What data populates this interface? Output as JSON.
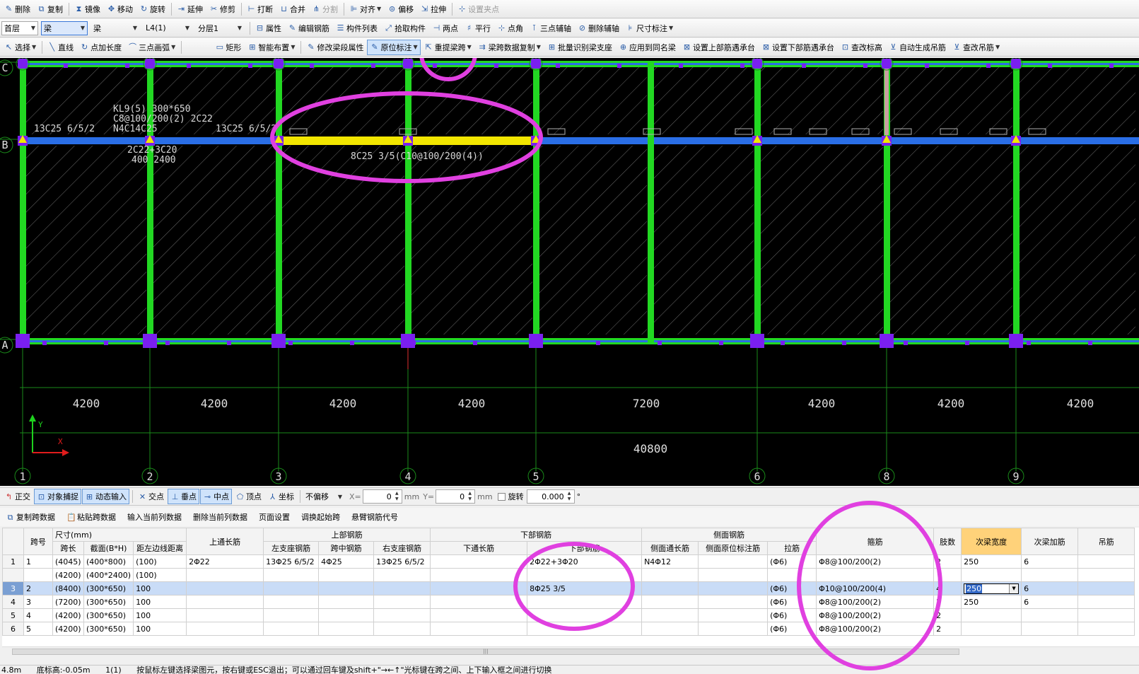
{
  "colors": {
    "accent_green": "#22d822",
    "beam_blue": "#2a6ee6",
    "selected_beam": "#f2e600",
    "column": "#7a1ff0",
    "highlight_circle": "#e040e0",
    "axis": "#a8a8a8",
    "grid_line": "#1a8a1a",
    "header_highlight": "#ffd27a"
  },
  "toolbar1": {
    "items": [
      {
        "label": "删除",
        "icon": "eraser-icon"
      },
      {
        "label": "复制",
        "icon": "copy-icon"
      },
      {
        "label": "镜像",
        "icon": "mirror-icon"
      },
      {
        "label": "移动",
        "icon": "move-icon"
      },
      {
        "label": "旋转",
        "icon": "rotate-icon"
      },
      {
        "label": "延伸",
        "icon": "extend-icon"
      },
      {
        "label": "修剪",
        "icon": "trim-icon"
      },
      {
        "label": "打断",
        "icon": "break-icon"
      },
      {
        "label": "合并",
        "icon": "merge-icon"
      },
      {
        "label": "分割",
        "icon": "split-icon"
      },
      {
        "label": "对齐",
        "icon": "align-icon"
      },
      {
        "label": "偏移",
        "icon": "offset-icon"
      },
      {
        "label": "拉伸",
        "icon": "stretch-icon"
      },
      {
        "label": "设置夹点",
        "icon": "grip-icon"
      }
    ]
  },
  "toolbar2": {
    "floor": "首层",
    "category": "梁",
    "type": "梁",
    "component": "L4(1)",
    "layer": "分层1",
    "items": [
      {
        "label": "属性"
      },
      {
        "label": "编辑钢筋"
      },
      {
        "label": "构件列表"
      },
      {
        "label": "拾取构件"
      },
      {
        "label": "两点"
      },
      {
        "label": "平行"
      },
      {
        "label": "点角"
      },
      {
        "label": "三点辅轴"
      },
      {
        "label": "删除辅轴"
      },
      {
        "label": "尺寸标注"
      }
    ]
  },
  "toolbar3": {
    "items": [
      {
        "label": "选择"
      },
      {
        "label": "直线"
      },
      {
        "label": "点加长度"
      },
      {
        "label": "三点画弧"
      },
      {
        "label": "矩形"
      },
      {
        "label": "智能布置"
      },
      {
        "label": "修改梁段属性"
      },
      {
        "label": "原位标注"
      },
      {
        "label": "重提梁跨"
      },
      {
        "label": "梁跨数据复制"
      },
      {
        "label": "批量识别梁支座"
      },
      {
        "label": "应用到同名梁"
      },
      {
        "label": "设置上部筋遇承台"
      },
      {
        "label": "设置下部筋遇承台"
      },
      {
        "label": "查改标高"
      },
      {
        "label": "自动生成吊筋"
      },
      {
        "label": "查改吊筋"
      }
    ]
  },
  "canvas": {
    "row_axes": [
      "C",
      "B",
      "A"
    ],
    "column_axes": [
      "1",
      "2",
      "3",
      "4",
      "5",
      "6",
      "8",
      "9"
    ],
    "span_dims": [
      "4200",
      "4200",
      "4200",
      "4200",
      "7200",
      "4200",
      "4200",
      "4200"
    ],
    "total_dim": "40800",
    "labels": {
      "beam_name": "KL9(5) 300*650",
      "stirrup": "C8@100/200(2) 2C22",
      "side": "N4C14C25",
      "left_support": "13C25 6/5/2",
      "right_support": "13C25 6/5/2",
      "bottom1": "2C22+3C20",
      "bottom1b": "400 2400",
      "selected_bottom": "8C25 3/5(C10@100/200(4))"
    },
    "ucs": {
      "x": "X",
      "y": "Y"
    }
  },
  "statusbar": {
    "ortho": "正交",
    "snap": "对象捕捉",
    "dyn": "动态输入",
    "intersect": "交点",
    "perp": "垂点",
    "mid": "中点",
    "vertex": "顶点",
    "coord": "坐标",
    "offset": "不偏移",
    "x_label": "X=",
    "x_val": "0",
    "y_label": "Y=",
    "y_val": "0",
    "unit": "mm",
    "rotate": "旋转",
    "rotate_val": "0.000",
    "degree": "°"
  },
  "grid_toolbar": {
    "items": [
      "复制跨数据",
      "粘贴跨数据",
      "输入当前列数据",
      "删除当前列数据",
      "页面设置",
      "调换起始跨",
      "悬臂钢筋代号"
    ]
  },
  "table": {
    "group_headers": {
      "span_no": "跨号",
      "size": "尺寸(mm)",
      "top_long": "上通长筋",
      "top_bars": "上部钢筋",
      "bottom_bars": "下部钢筋",
      "side_bars": "侧面钢筋",
      "stirrup": "箍筋",
      "legs": "肢数",
      "sec_width": "次梁宽度",
      "sec_add": "次梁加筋",
      "hanger": "吊筋"
    },
    "sub_headers": {
      "len": "跨长",
      "section": "截面(B*H)",
      "dist": "距左边线距离",
      "left_sup": "左支座钢筋",
      "mid": "跨中钢筋",
      "right_sup": "右支座钢筋",
      "bot_long": "下通长筋",
      "bot": "下部钢筋",
      "side_long": "侧面通长筋",
      "side_orig": "侧面原位标注筋",
      "tie": "拉筋"
    },
    "rows": [
      {
        "rn": "1",
        "span": "1",
        "len": "(4045)",
        "sec": "(400*800)",
        "dist": "(100)",
        "top_long": "2Φ22",
        "left": "13Φ25 6/5/2",
        "mid": "4Φ25",
        "right": "13Φ25 6/5/2",
        "bot_long": "",
        "bot": "2Φ22+3Φ20",
        "side_long": "N4Φ12",
        "side_orig": "",
        "tie": "(Φ6)",
        "stir": "Φ8@100/200(2)",
        "legs": "2",
        "sw": "250",
        "sa": "6",
        "hang": ""
      },
      {
        "rn": "",
        "span": "",
        "len": "(4200)",
        "sec": "(400*2400)",
        "dist": "(100)",
        "top_long": "",
        "left": "",
        "mid": "",
        "right": "",
        "bot_long": "",
        "bot": "",
        "side_long": "",
        "side_orig": "",
        "tie": "",
        "stir": "",
        "legs": "",
        "sw": "",
        "sa": "",
        "hang": ""
      },
      {
        "rn": "3",
        "span": "2",
        "len": "(8400)",
        "sec": "(300*650)",
        "dist": "100",
        "top_long": "",
        "left": "",
        "mid": "",
        "right": "",
        "bot_long": "",
        "bot": "8Φ25 3/5",
        "side_long": "",
        "side_orig": "",
        "tie": "(Φ6)",
        "stir": "Φ10@100/200(4)",
        "legs": "4",
        "sw": "250",
        "sa": "6",
        "hang": ""
      },
      {
        "rn": "4",
        "span": "3",
        "len": "(7200)",
        "sec": "(300*650)",
        "dist": "100",
        "top_long": "",
        "left": "",
        "mid": "",
        "right": "",
        "bot_long": "",
        "bot": "",
        "side_long": "",
        "side_orig": "",
        "tie": "(Φ6)",
        "stir": "Φ8@100/200(2)",
        "legs": "2",
        "sw": "250",
        "sa": "6",
        "hang": ""
      },
      {
        "rn": "5",
        "span": "4",
        "len": "(4200)",
        "sec": "(300*650)",
        "dist": "100",
        "top_long": "",
        "left": "",
        "mid": "",
        "right": "",
        "bot_long": "",
        "bot": "",
        "side_long": "",
        "side_orig": "",
        "tie": "(Φ6)",
        "stir": "Φ8@100/200(2)",
        "legs": "2",
        "sw": "",
        "sa": "",
        "hang": ""
      },
      {
        "rn": "6",
        "span": "5",
        "len": "(4200)",
        "sec": "(300*650)",
        "dist": "100",
        "top_long": "",
        "left": "",
        "mid": "",
        "right": "",
        "bot_long": "",
        "bot": "",
        "side_long": "",
        "side_orig": "",
        "tie": "(Φ6)",
        "stir": "Φ8@100/200(2)",
        "legs": "2",
        "sw": "",
        "sa": "",
        "hang": ""
      }
    ]
  },
  "bottom": {
    "floor_h": "4.8m",
    "bottom_elev": "底标高:-0.05m",
    "count": "1(1)",
    "hint": "按鼠标左键选择梁图元，按右键或ESC退出；可以通过回车键及shift+\"→←↑\"光标键在跨之间、上下输入框之间进行切换"
  }
}
